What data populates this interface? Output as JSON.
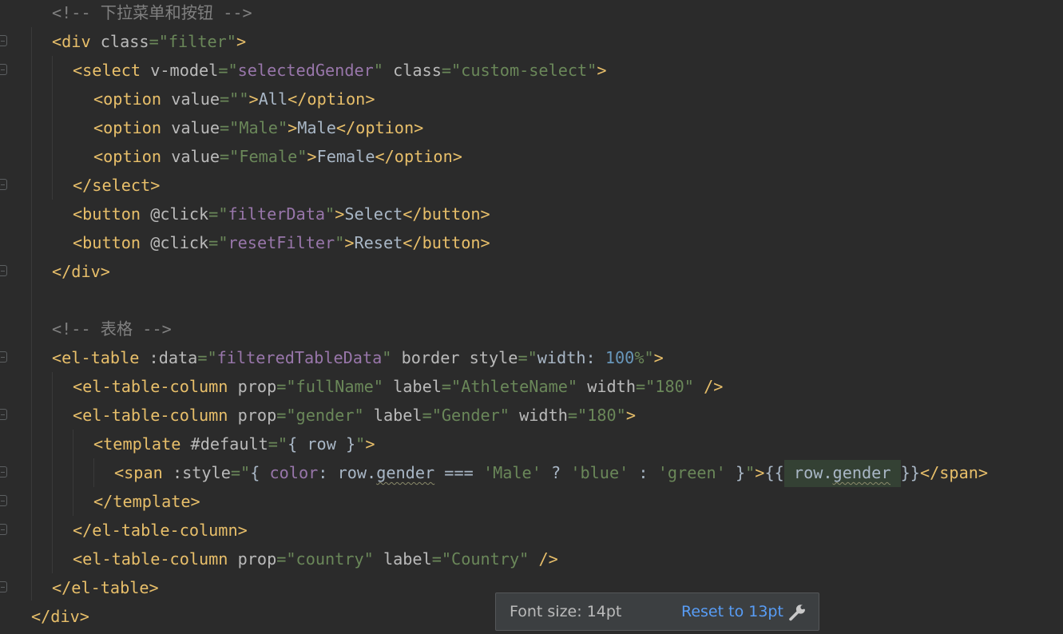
{
  "code_lines": [
    [
      {
        "t": "<!-- 下拉菜单和按钮 -->",
        "c": "cmt"
      }
    ],
    [
      {
        "t": "<div ",
        "c": "tag"
      },
      {
        "t": "class",
        "c": "attr"
      },
      {
        "t": "=\"filter\"",
        "c": "str"
      },
      {
        "t": ">",
        "c": "tag"
      }
    ],
    [
      {
        "t": "<select ",
        "c": "tag"
      },
      {
        "t": "v-model",
        "c": "attr"
      },
      {
        "t": "=\"",
        "c": "str"
      },
      {
        "t": "selectedGender",
        "c": "strv"
      },
      {
        "t": "\" ",
        "c": "str"
      },
      {
        "t": "class",
        "c": "attr"
      },
      {
        "t": "=\"custom-select\"",
        "c": "str"
      },
      {
        "t": ">",
        "c": "tag"
      }
    ],
    [
      {
        "t": "<option ",
        "c": "tag"
      },
      {
        "t": "value",
        "c": "attr"
      },
      {
        "t": "=\"\"",
        "c": "str"
      },
      {
        "t": ">",
        "c": "tag"
      },
      {
        "t": "All",
        "c": "txt"
      },
      {
        "t": "</option>",
        "c": "tag"
      }
    ],
    [
      {
        "t": "<option ",
        "c": "tag"
      },
      {
        "t": "value",
        "c": "attr"
      },
      {
        "t": "=\"Male\"",
        "c": "str"
      },
      {
        "t": ">",
        "c": "tag"
      },
      {
        "t": "Male",
        "c": "txt"
      },
      {
        "t": "</option>",
        "c": "tag"
      }
    ],
    [
      {
        "t": "<option ",
        "c": "tag"
      },
      {
        "t": "value",
        "c": "attr"
      },
      {
        "t": "=\"Female\"",
        "c": "str"
      },
      {
        "t": ">",
        "c": "tag"
      },
      {
        "t": "Female",
        "c": "txt"
      },
      {
        "t": "</option>",
        "c": "tag"
      }
    ],
    [
      {
        "t": "</select>",
        "c": "tag"
      }
    ],
    [
      {
        "t": "<button ",
        "c": "tag"
      },
      {
        "t": "@click",
        "c": "attr"
      },
      {
        "t": "=\"",
        "c": "str"
      },
      {
        "t": "filterData",
        "c": "strv"
      },
      {
        "t": "\"",
        "c": "str"
      },
      {
        "t": ">",
        "c": "tag"
      },
      {
        "t": "Select",
        "c": "txt"
      },
      {
        "t": "</button>",
        "c": "tag"
      }
    ],
    [
      {
        "t": "<button ",
        "c": "tag"
      },
      {
        "t": "@click",
        "c": "attr"
      },
      {
        "t": "=\"",
        "c": "str"
      },
      {
        "t": "resetFilter",
        "c": "strv"
      },
      {
        "t": "\"",
        "c": "str"
      },
      {
        "t": ">",
        "c": "tag"
      },
      {
        "t": "Reset",
        "c": "txt"
      },
      {
        "t": "</button>",
        "c": "tag"
      }
    ],
    [
      {
        "t": "</div>",
        "c": "tag"
      }
    ],
    [],
    [
      {
        "t": "<!-- 表格 -->",
        "c": "cmt"
      }
    ],
    [
      {
        "t": "<el-table ",
        "c": "tag"
      },
      {
        "t": ":data",
        "c": "attr"
      },
      {
        "t": "=\"",
        "c": "str"
      },
      {
        "t": "filteredTableData",
        "c": "strv"
      },
      {
        "t": "\" ",
        "c": "str"
      },
      {
        "t": "border ",
        "c": "attr"
      },
      {
        "t": "style",
        "c": "attr"
      },
      {
        "t": "=\"",
        "c": "str"
      },
      {
        "t": "width",
        "c": "txt"
      },
      {
        "t": ": ",
        "c": "txt"
      },
      {
        "t": "100",
        "c": "num"
      },
      {
        "t": "%\"",
        "c": "str"
      },
      {
        "t": ">",
        "c": "tag"
      }
    ],
    [
      {
        "t": "<el-table-column ",
        "c": "tag"
      },
      {
        "t": "prop",
        "c": "attr"
      },
      {
        "t": "=\"fullName\" ",
        "c": "str"
      },
      {
        "t": "label",
        "c": "attr"
      },
      {
        "t": "=\"AthleteName\" ",
        "c": "str"
      },
      {
        "t": "width",
        "c": "attr"
      },
      {
        "t": "=\"180\" ",
        "c": "str"
      },
      {
        "t": "/>",
        "c": "tag"
      }
    ],
    [
      {
        "t": "<el-table-column ",
        "c": "tag"
      },
      {
        "t": "prop",
        "c": "attr"
      },
      {
        "t": "=\"gender\" ",
        "c": "str"
      },
      {
        "t": "label",
        "c": "attr"
      },
      {
        "t": "=\"Gender\" ",
        "c": "str"
      },
      {
        "t": "width",
        "c": "attr"
      },
      {
        "t": "=\"180\"",
        "c": "str"
      },
      {
        "t": ">",
        "c": "tag"
      }
    ],
    [
      {
        "t": "<template ",
        "c": "tag"
      },
      {
        "t": "#default",
        "c": "attr"
      },
      {
        "t": "=\"",
        "c": "str"
      },
      {
        "t": "{ row }",
        "c": "txt"
      },
      {
        "t": "\"",
        "c": "str"
      },
      {
        "t": ">",
        "c": "tag"
      }
    ],
    [
      {
        "t": "<span ",
        "c": "tag"
      },
      {
        "t": ":style",
        "c": "attr"
      },
      {
        "t": "=\"",
        "c": "str"
      },
      {
        "t": "{ ",
        "c": "txt"
      },
      {
        "t": "color",
        "c": "strv"
      },
      {
        "t": ": row.",
        "c": "txt"
      },
      {
        "t": "gender",
        "c": "txt",
        "u": 1
      },
      {
        "t": " === ",
        "c": "txt"
      },
      {
        "t": "'Male'",
        "c": "str"
      },
      {
        "t": " ? ",
        "c": "txt"
      },
      {
        "t": "'blue'",
        "c": "str"
      },
      {
        "t": " : ",
        "c": "txt"
      },
      {
        "t": "'green'",
        "c": "str"
      },
      {
        "t": " }",
        "c": "txt"
      },
      {
        "t": "\"",
        "c": "str"
      },
      {
        "t": ">",
        "c": "tag"
      },
      {
        "t": "{{",
        "c": "txt"
      },
      {
        "t": " row.",
        "c": "txt",
        "h": 1
      },
      {
        "t": "gender",
        "c": "txt",
        "h": 1,
        "u": 1
      },
      {
        "t": " ",
        "c": "txt",
        "h": 1
      },
      {
        "t": "}}",
        "c": "txt"
      },
      {
        "t": "</span>",
        "c": "tag"
      }
    ],
    [
      {
        "t": "</template>",
        "c": "tag"
      }
    ],
    [
      {
        "t": "</el-table-column>",
        "c": "tag"
      }
    ],
    [
      {
        "t": "<el-table-column ",
        "c": "tag"
      },
      {
        "t": "prop",
        "c": "attr"
      },
      {
        "t": "=\"country\" ",
        "c": "str"
      },
      {
        "t": "label",
        "c": "attr"
      },
      {
        "t": "=\"Country\" ",
        "c": "str"
      },
      {
        "t": "/>",
        "c": "tag"
      }
    ],
    [
      {
        "t": "</el-table>",
        "c": "tag"
      }
    ],
    [
      {
        "t": "</div>",
        "c": "tag"
      }
    ]
  ],
  "toast": {
    "message": "Font size: 14pt",
    "reset_label": "Reset to 13pt",
    "icon": "wrench-icon"
  },
  "colors": {
    "background": "#2b2b2b",
    "tag": "#e8bf6a",
    "attribute": "#bababa",
    "string": "#6a8759",
    "string_variable": "#9876aa",
    "number": "#6897bb",
    "comment": "#808080",
    "text": "#a9b7c6",
    "link": "#589df6"
  }
}
